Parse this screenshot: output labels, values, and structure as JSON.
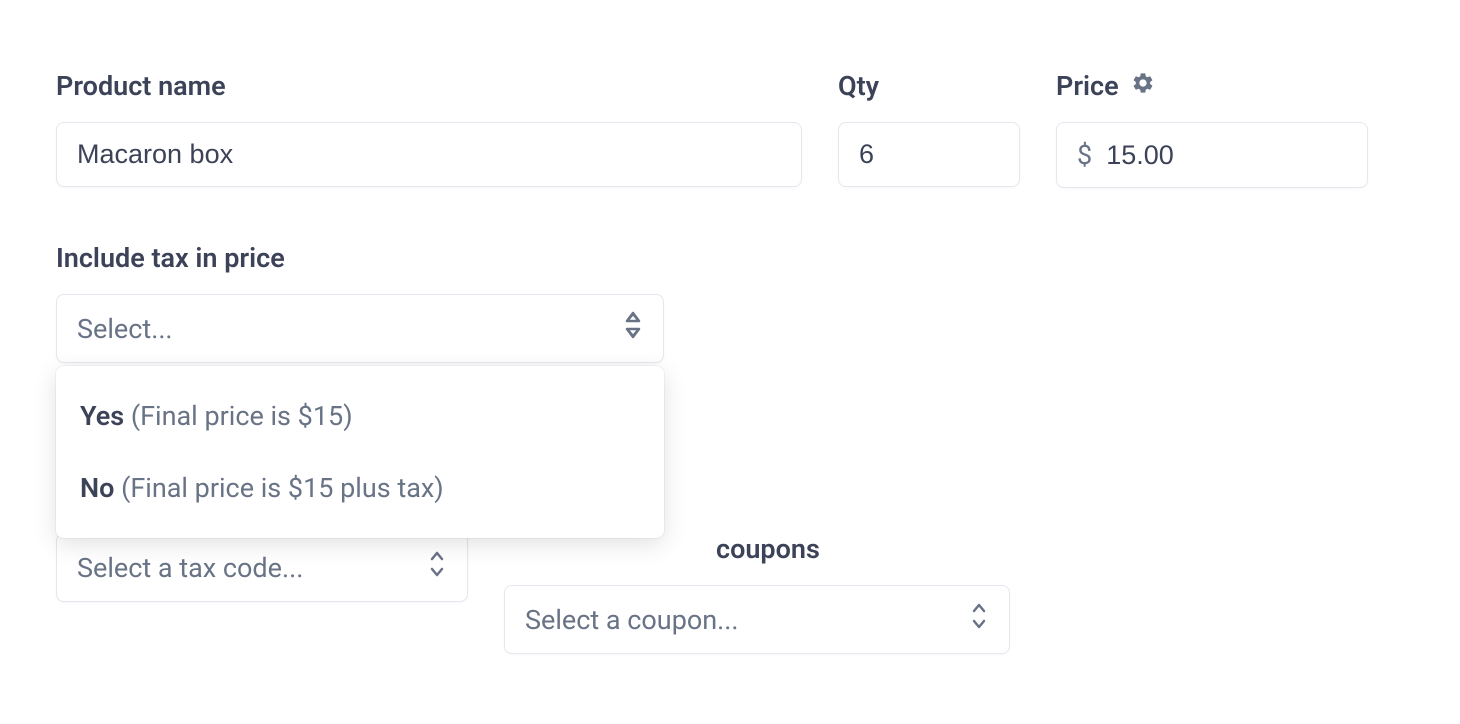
{
  "labels": {
    "product_name": "Product name",
    "qty": "Qty",
    "price": "Price",
    "include_tax": "Include tax in price",
    "coupons_visible": "coupons"
  },
  "fields": {
    "product_name_value": "Macaron box",
    "qty_value": "6",
    "currency_symbol": "$",
    "price_value": "15.00",
    "include_tax_placeholder": "Select...",
    "tax_code_placeholder": "Select a tax code...",
    "coupons_placeholder": "Select a coupon..."
  },
  "include_tax_options": {
    "yes_bold": "Yes",
    "yes_rest": " (Final price is $15)",
    "no_bold": "No",
    "no_rest": " (Final price is $15 plus tax)"
  }
}
